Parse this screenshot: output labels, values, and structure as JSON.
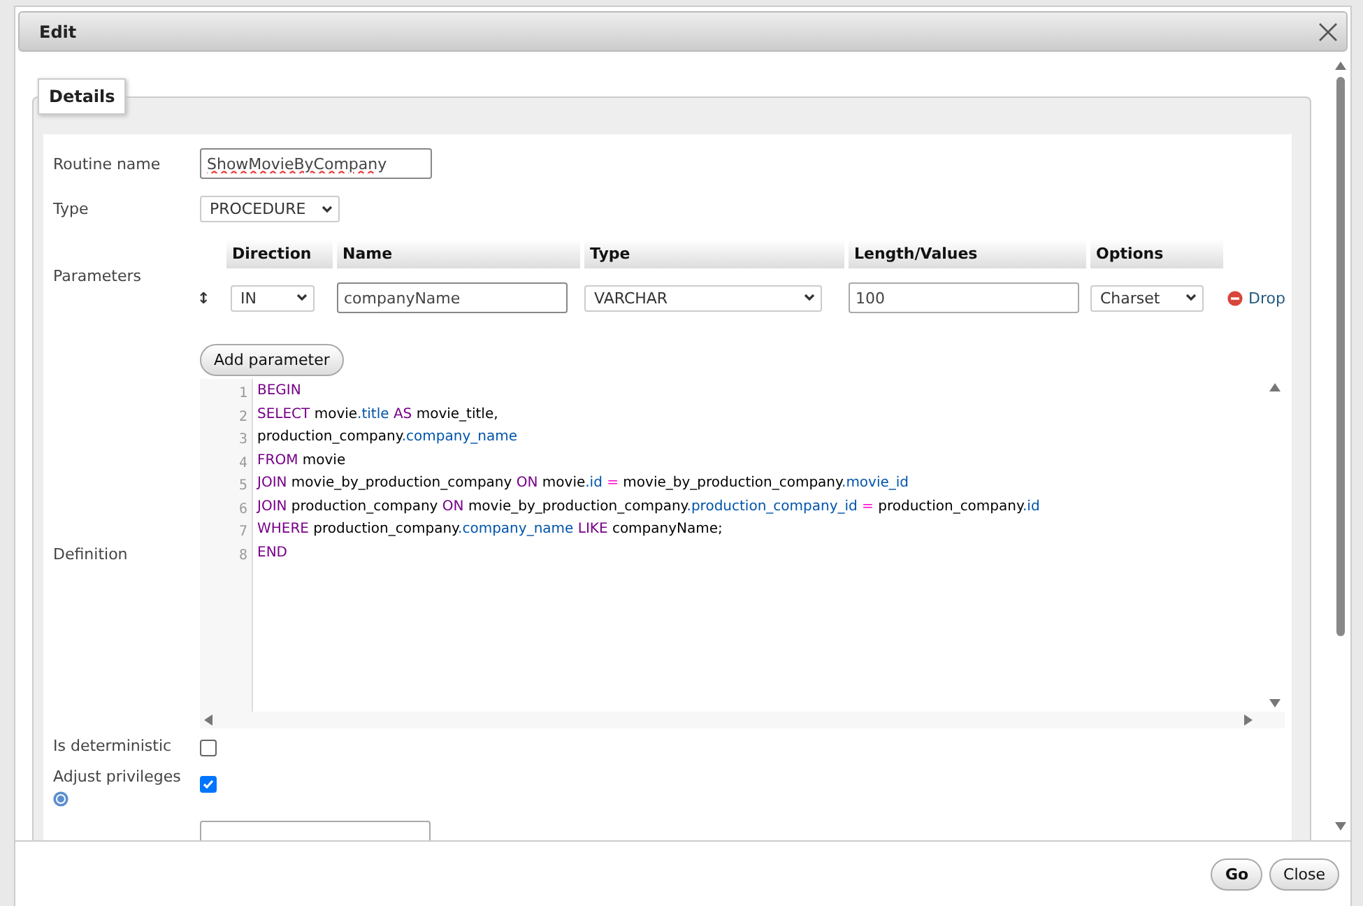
{
  "dialog": {
    "title": "Edit"
  },
  "fieldset": {
    "legend": "Details"
  },
  "routine_name": {
    "label": "Routine name",
    "value": "ShowMovieByCompany",
    "misspelled": true
  },
  "routine_type": {
    "label": "Type",
    "value": "PROCEDURE"
  },
  "parameters": {
    "label": "Parameters",
    "reorder_glyph": "↕",
    "columns": [
      "Direction",
      "Name",
      "Type",
      "Length/Values",
      "Options"
    ],
    "rows": [
      {
        "direction": "IN",
        "name": "companyName",
        "type": "VARCHAR",
        "length": "100",
        "options": "Charset",
        "drop_label": "Drop"
      }
    ],
    "add_button": "Add parameter"
  },
  "definition": {
    "label": "Definition",
    "lines": [
      {
        "number": "1",
        "tokens": [
          {
            "kind": "keyword",
            "text": "BEGIN"
          }
        ]
      },
      {
        "number": "2",
        "tokens": [
          {
            "kind": "keyword",
            "text": "SELECT"
          },
          {
            "kind": "plain",
            "text": " movie"
          },
          {
            "kind": "property",
            "text": ".title"
          },
          {
            "kind": "keyword",
            "text": " AS"
          },
          {
            "kind": "plain",
            "text": " movie_title,"
          }
        ]
      },
      {
        "number": "3",
        "tokens": [
          {
            "kind": "plain",
            "text": "production_company"
          },
          {
            "kind": "property",
            "text": ".company_name"
          }
        ]
      },
      {
        "number": "4",
        "tokens": [
          {
            "kind": "keyword",
            "text": "FROM"
          },
          {
            "kind": "plain",
            "text": " movie"
          }
        ]
      },
      {
        "number": "5",
        "tokens": [
          {
            "kind": "keyword",
            "text": "JOIN"
          },
          {
            "kind": "plain",
            "text": " movie_by_production_company "
          },
          {
            "kind": "keyword",
            "text": "ON"
          },
          {
            "kind": "plain",
            "text": " movie"
          },
          {
            "kind": "property",
            "text": ".id"
          },
          {
            "kind": "operator",
            "text": " ="
          },
          {
            "kind": "plain",
            "text": " movie_by_production_company"
          },
          {
            "kind": "property",
            "text": ".movie_id"
          }
        ]
      },
      {
        "number": "6",
        "tokens": [
          {
            "kind": "keyword",
            "text": "JOIN"
          },
          {
            "kind": "plain",
            "text": " production_company "
          },
          {
            "kind": "keyword",
            "text": "ON"
          },
          {
            "kind": "plain",
            "text": " movie_by_production_company"
          },
          {
            "kind": "property",
            "text": ".production_company_id"
          },
          {
            "kind": "operator",
            "text": " ="
          },
          {
            "kind": "plain",
            "text": " production_company"
          },
          {
            "kind": "property",
            "text": ".id"
          }
        ]
      },
      {
        "number": "7",
        "tokens": [
          {
            "kind": "keyword",
            "text": "WHERE"
          },
          {
            "kind": "plain",
            "text": " production_company"
          },
          {
            "kind": "property",
            "text": ".company_name"
          },
          {
            "kind": "keyword",
            "text": " LIKE"
          },
          {
            "kind": "plain",
            "text": " companyName;"
          }
        ]
      },
      {
        "number": "8",
        "tokens": [
          {
            "kind": "keyword",
            "text": "END"
          }
        ]
      }
    ]
  },
  "is_deterministic": {
    "label": "Is deterministic",
    "checked": false
  },
  "adjust_privileges": {
    "label": "Adjust privileges",
    "checked": true
  },
  "buttons": [
    {
      "label": "Go",
      "kind": "primary"
    },
    {
      "label": "Close",
      "kind": "secondary"
    }
  ]
}
